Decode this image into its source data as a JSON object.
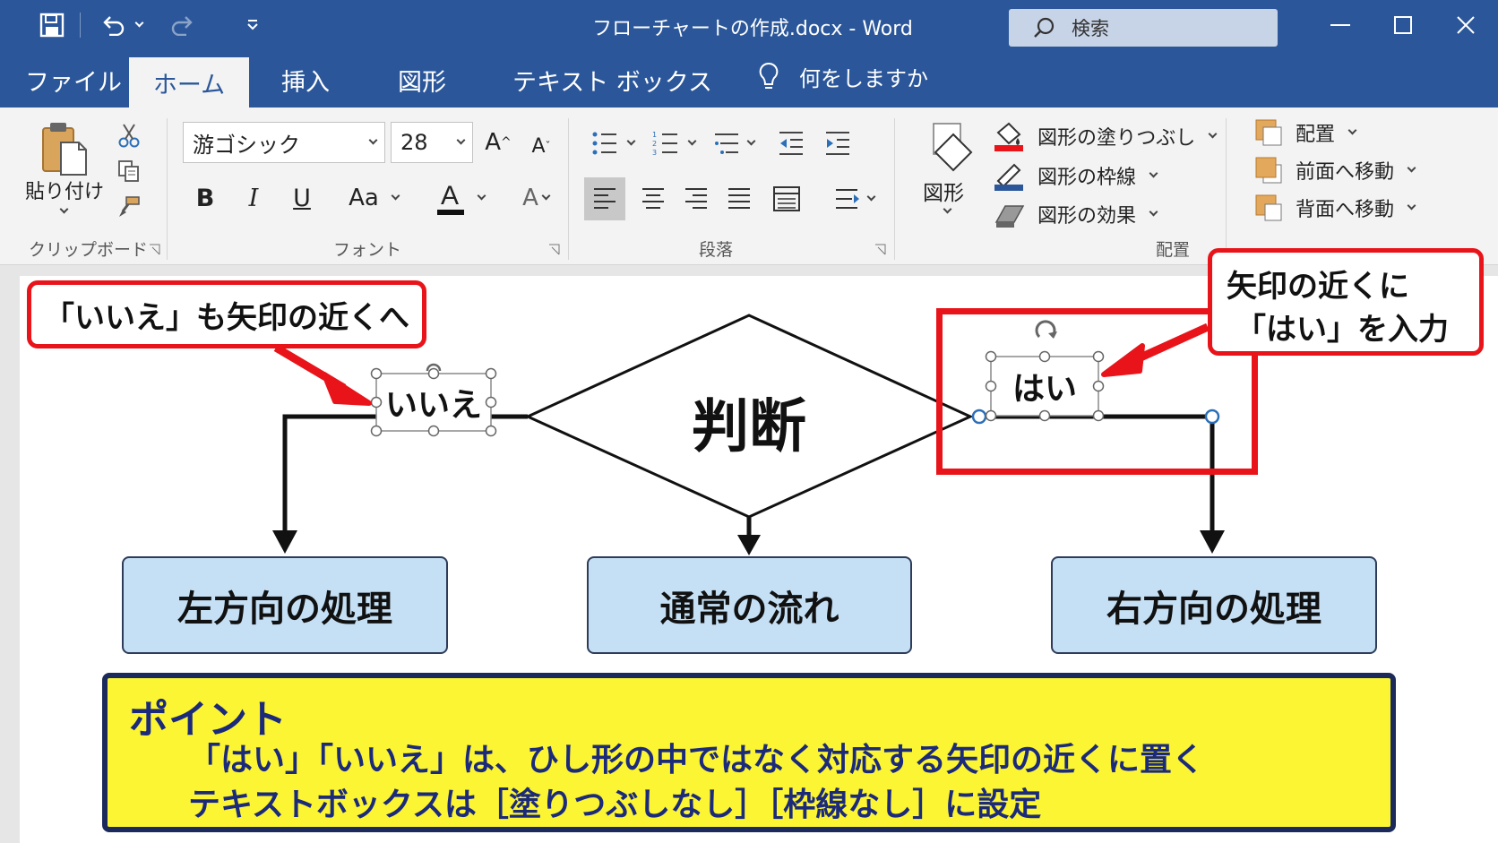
{
  "app": {
    "title": "フローチャートの作成.docx  -  Word",
    "search_placeholder": "検索"
  },
  "tabs": [
    {
      "label": "ファイル"
    },
    {
      "label": "ホーム",
      "active": true
    },
    {
      "label": "挿入"
    },
    {
      "label": "図形"
    },
    {
      "label": "テキスト ボックス"
    }
  ],
  "tell_me": "何をしますか",
  "ribbon": {
    "clipboard": {
      "paste_label": "貼り付け",
      "group_label": "クリップボード"
    },
    "font": {
      "font_name": "游ゴシック",
      "font_size": "28",
      "group_label": "フォント",
      "bold": "B",
      "italic": "I",
      "underline": "U",
      "case": "Aa"
    },
    "paragraph": {
      "group_label": "段落"
    },
    "shape": {
      "shapes_label": "図形",
      "fill_label": "図形の塗りつぶし",
      "outline_label": "図形の枠線",
      "effects_label": "図形の効果",
      "group_label": "配置"
    },
    "arrange": {
      "position_label": "配置",
      "forward_label": "前面へ移動",
      "backward_label": "背面へ移動"
    }
  },
  "flowchart": {
    "decision": "判断",
    "no_label": "いいえ",
    "yes_label": "はい",
    "left_process": "左方向の処理",
    "center_process": "通常の流れ",
    "right_process": "右方向の処理"
  },
  "callouts": {
    "left": "「いいえ」も矢印の近くへ",
    "right_line1": "矢印の近くに",
    "right_line2": "「はい」を入力"
  },
  "point": {
    "title": "ポイント",
    "line1": "「はい」「いいえ」は、ひし形の中ではなく対応する矢印の近くに置く",
    "line2": "テキストボックスは［塗りつぶしなし］［枠線なし］に設定"
  },
  "colors": {
    "word_blue": "#2b579a",
    "callout_red": "#e8141a",
    "process_fill": "#c5e0f5",
    "point_fill": "#fcf533",
    "point_text": "#1b2a7a"
  }
}
